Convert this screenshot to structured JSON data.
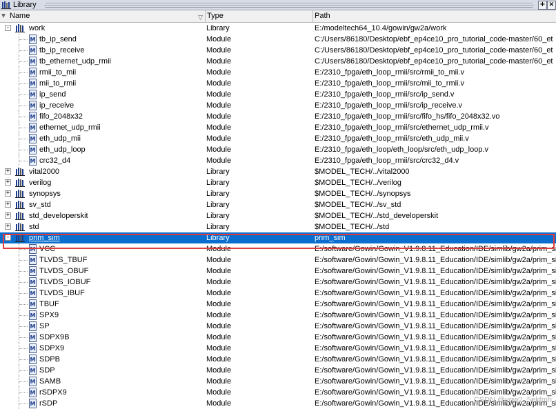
{
  "window": {
    "title": "Library"
  },
  "columns": {
    "name": "Name",
    "type": "Type",
    "path": "Path"
  },
  "rows": [
    {
      "name": "work",
      "type": "Library",
      "path": "E:/modeltech64_10.4/gowin/gw2a/work",
      "kind": "library",
      "expander": "-",
      "level": 0
    },
    {
      "name": "tb_ip_send",
      "type": "Module",
      "path": "C:/Users/86180/Desktop/ebf_ep4ce10_pro_tutorial_code-master/60_et",
      "kind": "module",
      "level": 1
    },
    {
      "name": "tb_ip_receive",
      "type": "Module",
      "path": "C:/Users/86180/Desktop/ebf_ep4ce10_pro_tutorial_code-master/60_et",
      "kind": "module",
      "level": 1
    },
    {
      "name": "tb_ethernet_udp_rmii",
      "type": "Module",
      "path": "C:/Users/86180/Desktop/ebf_ep4ce10_pro_tutorial_code-master/60_et",
      "kind": "module",
      "level": 1
    },
    {
      "name": "rmii_to_mii",
      "type": "Module",
      "path": "E:/2310_fpga/eth_loop_rmii/src/rmii_to_mii.v",
      "kind": "module",
      "level": 1
    },
    {
      "name": "mii_to_rmii",
      "type": "Module",
      "path": "E:/2310_fpga/eth_loop_rmii/src/mii_to_rmii.v",
      "kind": "module",
      "level": 1
    },
    {
      "name": "ip_send",
      "type": "Module",
      "path": "E:/2310_fpga/eth_loop_rmii/src/ip_send.v",
      "kind": "module",
      "level": 1
    },
    {
      "name": "ip_receive",
      "type": "Module",
      "path": "E:/2310_fpga/eth_loop_rmii/src/ip_receive.v",
      "kind": "module",
      "level": 1
    },
    {
      "name": "fifo_2048x32",
      "type": "Module",
      "path": "E:/2310_fpga/eth_loop_rmii/src/fifo_hs/fifo_2048x32.vo",
      "kind": "module",
      "level": 1
    },
    {
      "name": "ethernet_udp_rmii",
      "type": "Module",
      "path": "E:/2310_fpga/eth_loop_rmii/src/ethernet_udp_rmii.v",
      "kind": "module",
      "level": 1
    },
    {
      "name": "eth_udp_mii",
      "type": "Module",
      "path": "E:/2310_fpga/eth_loop_rmii/src/eth_udp_mii.v",
      "kind": "module",
      "level": 1
    },
    {
      "name": "eth_udp_loop",
      "type": "Module",
      "path": "E:/2310_fpga/eth_loop/eth_loop/src/eth_udp_loop.v",
      "kind": "module",
      "level": 1
    },
    {
      "name": "crc32_d4",
      "type": "Module",
      "path": "E:/2310_fpga/eth_loop_rmii/src/crc32_d4.v",
      "kind": "module",
      "level": 1
    },
    {
      "name": "vital2000",
      "type": "Library",
      "path": "$MODEL_TECH/../vital2000",
      "kind": "library",
      "expander": "+",
      "level": 0
    },
    {
      "name": "verilog",
      "type": "Library",
      "path": "$MODEL_TECH/../verilog",
      "kind": "library",
      "expander": "+",
      "level": 0
    },
    {
      "name": "synopsys",
      "type": "Library",
      "path": "$MODEL_TECH/../synopsys",
      "kind": "library",
      "expander": "+",
      "level": 0
    },
    {
      "name": "sv_std",
      "type": "Library",
      "path": "$MODEL_TECH/../sv_std",
      "kind": "library",
      "expander": "+",
      "level": 0
    },
    {
      "name": "std_developerskit",
      "type": "Library",
      "path": "$MODEL_TECH/../std_developerskit",
      "kind": "library",
      "expander": "+",
      "level": 0
    },
    {
      "name": "std",
      "type": "Library",
      "path": "$MODEL_TECH/../std",
      "kind": "library",
      "expander": "+",
      "level": 0
    },
    {
      "name": "prim_sim",
      "type": "Library",
      "path": "prim_sim",
      "kind": "library",
      "expander": "-",
      "level": 0,
      "selected": true
    },
    {
      "name": "VCC",
      "type": "Module",
      "path": "E:/software/Gowin/Gowin_V1.9.8.11_Education/IDE/simlib/gw2a/prim_si",
      "kind": "module",
      "level": 1
    },
    {
      "name": "TLVDS_TBUF",
      "type": "Module",
      "path": "E:/software/Gowin/Gowin_V1.9.8.11_Education/IDE/simlib/gw2a/prim_si",
      "kind": "module",
      "level": 1
    },
    {
      "name": "TLVDS_OBUF",
      "type": "Module",
      "path": "E:/software/Gowin/Gowin_V1.9.8.11_Education/IDE/simlib/gw2a/prim_si",
      "kind": "module",
      "level": 1
    },
    {
      "name": "TLVDS_IOBUF",
      "type": "Module",
      "path": "E:/software/Gowin/Gowin_V1.9.8.11_Education/IDE/simlib/gw2a/prim_si",
      "kind": "module",
      "level": 1
    },
    {
      "name": "TLVDS_IBUF",
      "type": "Module",
      "path": "E:/software/Gowin/Gowin_V1.9.8.11_Education/IDE/simlib/gw2a/prim_si",
      "kind": "module",
      "level": 1
    },
    {
      "name": "TBUF",
      "type": "Module",
      "path": "E:/software/Gowin/Gowin_V1.9.8.11_Education/IDE/simlib/gw2a/prim_si",
      "kind": "module",
      "level": 1
    },
    {
      "name": "SPX9",
      "type": "Module",
      "path": "E:/software/Gowin/Gowin_V1.9.8.11_Education/IDE/simlib/gw2a/prim_si",
      "kind": "module",
      "level": 1
    },
    {
      "name": "SP",
      "type": "Module",
      "path": "E:/software/Gowin/Gowin_V1.9.8.11_Education/IDE/simlib/gw2a/prim_si",
      "kind": "module",
      "level": 1
    },
    {
      "name": "SDPX9B",
      "type": "Module",
      "path": "E:/software/Gowin/Gowin_V1.9.8.11_Education/IDE/simlib/gw2a/prim_si",
      "kind": "module",
      "level": 1
    },
    {
      "name": "SDPX9",
      "type": "Module",
      "path": "E:/software/Gowin/Gowin_V1.9.8.11_Education/IDE/simlib/gw2a/prim_si",
      "kind": "module",
      "level": 1
    },
    {
      "name": "SDPB",
      "type": "Module",
      "path": "E:/software/Gowin/Gowin_V1.9.8.11_Education/IDE/simlib/gw2a/prim_si",
      "kind": "module",
      "level": 1
    },
    {
      "name": "SDP",
      "type": "Module",
      "path": "E:/software/Gowin/Gowin_V1.9.8.11_Education/IDE/simlib/gw2a/prim_si",
      "kind": "module",
      "level": 1
    },
    {
      "name": "SAMB",
      "type": "Module",
      "path": "E:/software/Gowin/Gowin_V1.9.8.11_Education/IDE/simlib/gw2a/prim_si",
      "kind": "module",
      "level": 1
    },
    {
      "name": "rSDPX9",
      "type": "Module",
      "path": "E:/software/Gowin/Gowin_V1.9.8.11_Education/IDE/simlib/gw2a/prim_si",
      "kind": "module",
      "level": 1
    },
    {
      "name": "rSDP",
      "type": "Module",
      "path": "E:/software/Gowin/Gowin_V1.9.8.11_Education/IDE/simlib/gw2a/prim_si",
      "kind": "module",
      "level": 1
    }
  ],
  "watermark": "CSDN @ygw2_5ekfmh",
  "colors": {
    "selection": "#0a6ecf",
    "highlight_outline": "#e23b3b",
    "header_bg": "#f0f0f0"
  }
}
